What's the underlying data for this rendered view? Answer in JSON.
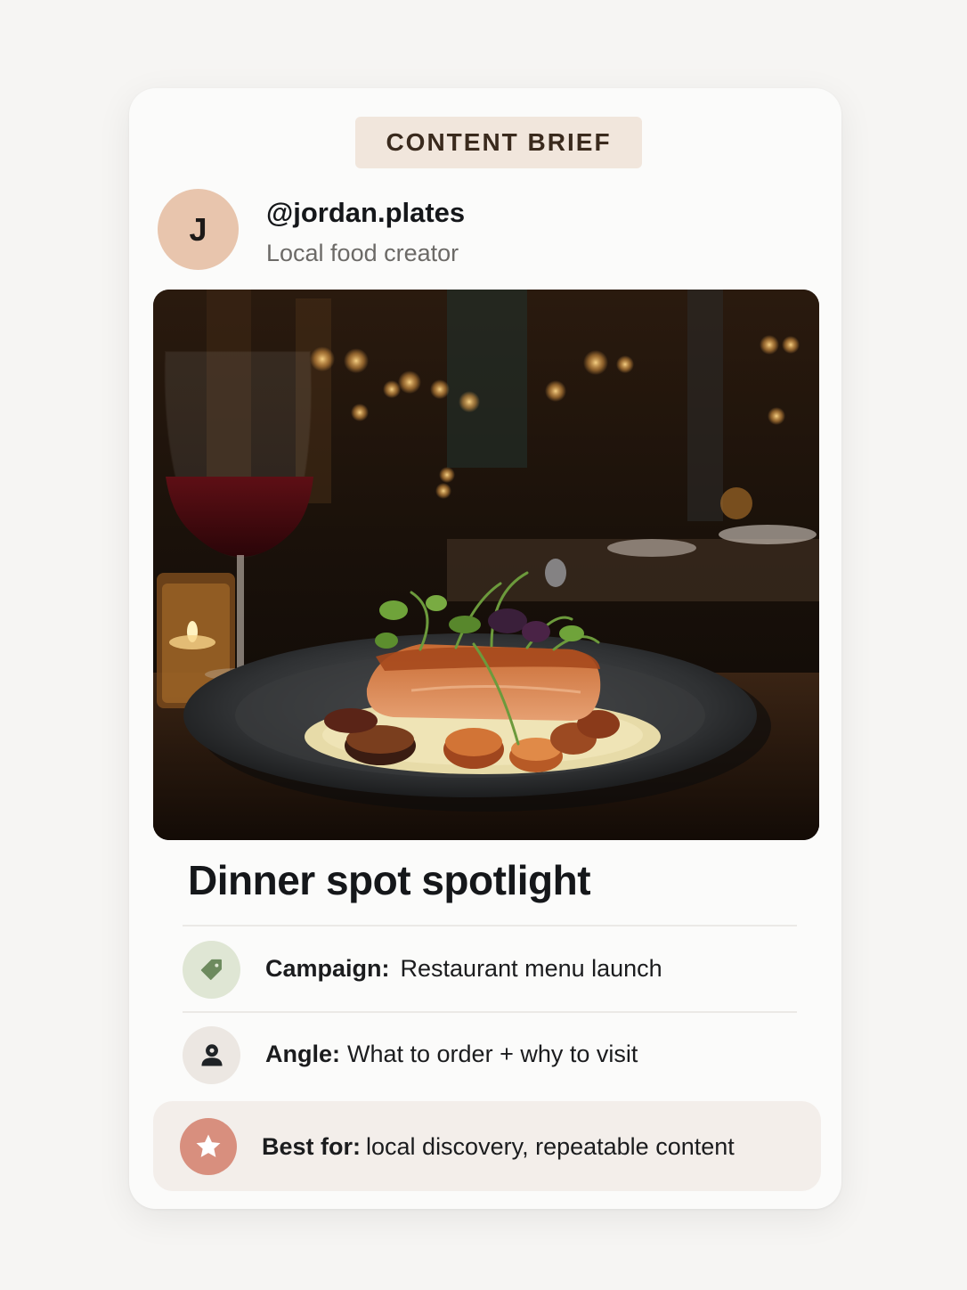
{
  "badge": {
    "label": "CONTENT BRIEF"
  },
  "creator": {
    "initial": "J",
    "handle": "@jordan.plates",
    "role": "Local food creator"
  },
  "post": {
    "title": "Dinner spot spotlight"
  },
  "details": {
    "campaign_label": "Campaign:",
    "campaign_value": "Restaurant menu launch",
    "angle_label": "Angle:",
    "angle_value": "What to order + why to visit",
    "best_label": "Best for:",
    "best_value": "local discovery, repeatable content"
  },
  "icons": {
    "campaign": "tag-icon",
    "angle": "person-icon",
    "best": "star-icon"
  },
  "colors": {
    "badge_bg": "#f1e6dc",
    "avatar_bg": "#e8c5ad",
    "tag_icon_bg": "#dfe6d4",
    "person_icon_bg": "#ece7e2",
    "star_icon_bg": "#d88f7e",
    "best_box_bg": "#f3eeea"
  }
}
